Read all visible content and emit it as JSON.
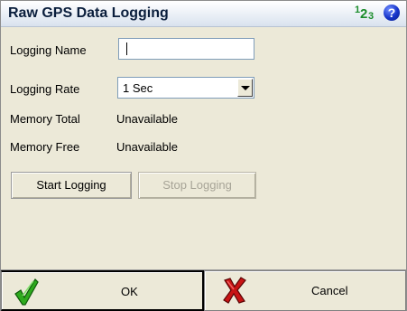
{
  "window": {
    "title": "Raw GPS Data Logging"
  },
  "header_icons": {
    "input_mode": {
      "icon": "number-input-mode-icon",
      "chars": [
        "1",
        "2",
        "3"
      ]
    },
    "help": {
      "icon": "help-icon",
      "glyph": "?"
    }
  },
  "form": {
    "logging_name": {
      "label": "Logging Name",
      "value": "",
      "placeholder": ""
    },
    "logging_rate": {
      "label": "Logging Rate",
      "selected": "1 Sec"
    },
    "memory_total": {
      "label": "Memory Total",
      "value": "Unavailable"
    },
    "memory_free": {
      "label": "Memory Free",
      "value": "Unavailable"
    }
  },
  "buttons": {
    "start": "Start Logging",
    "stop": "Stop Logging"
  },
  "footer": {
    "ok": "OK",
    "cancel": "Cancel"
  },
  "colors": {
    "title_text": "#0a1e3c",
    "check": "#2eaa1d",
    "cross": "#c81414",
    "help": "#1533c8",
    "input_mode": "#1a8c2a"
  }
}
